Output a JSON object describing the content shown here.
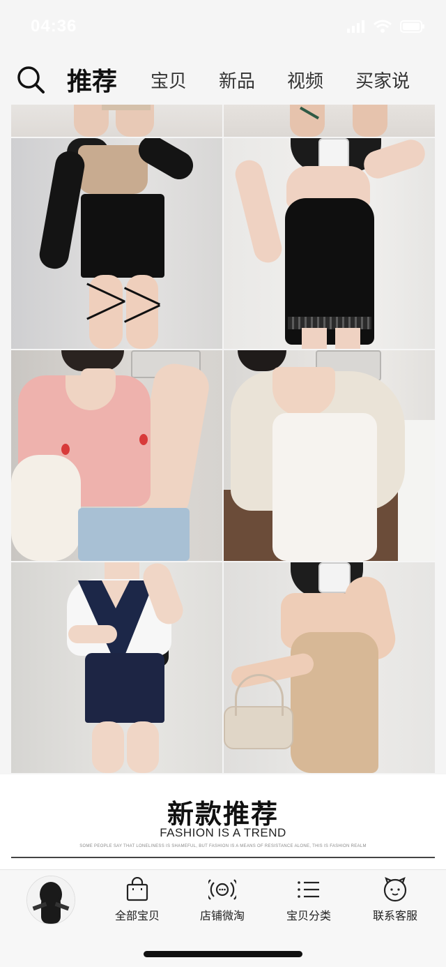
{
  "status_bar": {
    "time": "04:36"
  },
  "header": {
    "tabs": [
      {
        "label": "推荐",
        "active": true
      },
      {
        "label": "宝贝",
        "active": false
      },
      {
        "label": "新品",
        "active": false
      },
      {
        "label": "视频",
        "active": false
      },
      {
        "label": "买家说",
        "active": false
      }
    ],
    "search_icon": "search-icon"
  },
  "grid": {
    "items": [
      {
        "name": "partial-product-top-left"
      },
      {
        "name": "partial-product-top-right"
      },
      {
        "name": "product-black-skirt-set"
      },
      {
        "name": "product-black-lace-dress"
      },
      {
        "name": "product-pink-crop-top"
      },
      {
        "name": "product-white-cardigan-set"
      },
      {
        "name": "product-sailor-set"
      },
      {
        "name": "product-beige-one-shoulder-dress"
      }
    ]
  },
  "banner": {
    "title": "新款推荐",
    "subtitle": "FASHION IS A TREND",
    "fine_print": "SOME PEOPLE SAY THAT LONELINESS IS SHAMEFUL, BUT FASHION IS A MEANS OF RESISTANCE ALONE, THIS IS FASHION REALM"
  },
  "bottom_nav": {
    "items": [
      {
        "label": "全部宝贝",
        "icon": "shopping-bag-icon"
      },
      {
        "label": "店铺微淘",
        "icon": "broadcast-icon"
      },
      {
        "label": "宝贝分类",
        "icon": "list-icon"
      },
      {
        "label": "联系客服",
        "icon": "customer-service-icon"
      }
    ]
  },
  "colors": {
    "background": "#f5f5f5",
    "text": "#111111",
    "accent_black": "#000000"
  }
}
